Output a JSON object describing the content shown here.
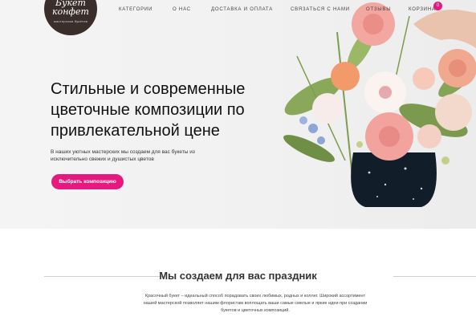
{
  "logo": {
    "line1": "Букет",
    "line2": "конфет",
    "tagline": "мастерская букетов"
  },
  "nav": {
    "items": [
      "КАТЕГОРИИ",
      "О НАС",
      "ДОСТАВКА И ОПЛАТА",
      "СВЯЗАТЬСЯ С НАМИ",
      "ОТЗЫВЫ",
      "КОРЗИНА"
    ],
    "cart_count": "0"
  },
  "hero": {
    "headline": "Стильные и современные цветочные композиции по привлекательной цене",
    "subtitle": "В наших уютных мастерских мы создаем для вас букеты из исключительно свежих и душистых цветов",
    "cta_label": "Выбрать композицию"
  },
  "section": {
    "title": "Мы создаем для вас праздник",
    "text": "Красочный букет – идеальный способ порадовать своих любимых, родных и коллег. Широкий ассортимент нашей мастерской позволяет нашим флористам воплощать ваши самые смелые и яркие идеи при создании букетов и цветочных композиций."
  },
  "colors": {
    "accent": "#e5197e",
    "logo_bg": "#3a2e2b"
  }
}
